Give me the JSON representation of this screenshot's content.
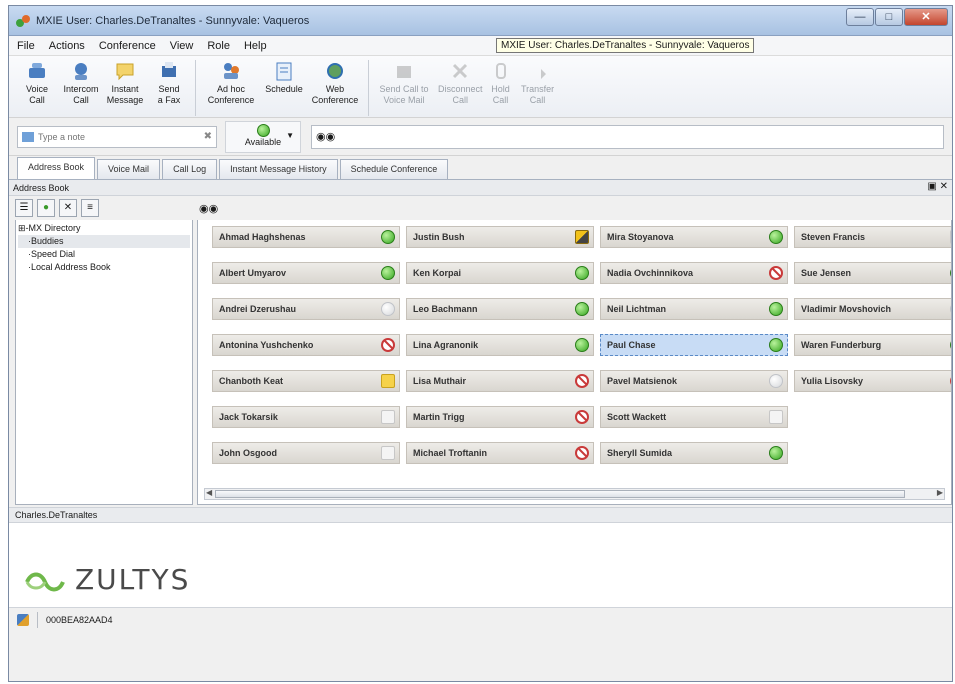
{
  "window": {
    "title": "MXIE User: Charles.DeTranaltes - Sunnyvale: Vaqueros",
    "tooltip": "MXIE User: Charles.DeTranaltes - Sunnyvale: Vaqueros"
  },
  "menu": [
    "File",
    "Actions",
    "Conference",
    "View",
    "Role",
    "Help"
  ],
  "toolbar": {
    "group1": [
      {
        "label": "Voice\nCall",
        "icon": "voice-call-icon"
      },
      {
        "label": "Intercom\nCall",
        "icon": "intercom-icon"
      },
      {
        "label": "Instant\nMessage",
        "icon": "instant-message-icon"
      },
      {
        "label": "Send\na Fax",
        "icon": "fax-icon"
      }
    ],
    "group2": [
      {
        "label": "Ad hoc\nConference",
        "icon": "adhoc-conference-icon"
      },
      {
        "label": "Schedule",
        "icon": "schedule-icon"
      },
      {
        "label": "Web\nConference",
        "icon": "web-conference-icon"
      }
    ],
    "group3": [
      {
        "label": "Send Call to\nVoice Mail",
        "icon": "voicemail-icon"
      },
      {
        "label": "Disconnect\nCall",
        "icon": "disconnect-icon"
      },
      {
        "label": "Hold\nCall",
        "icon": "hold-icon"
      },
      {
        "label": "Transfer\nCall",
        "icon": "transfer-icon"
      }
    ]
  },
  "note": {
    "placeholder": "Type a note"
  },
  "presence": {
    "label": "Available"
  },
  "tabs": [
    "Address Book",
    "Voice Mail",
    "Call Log",
    "Instant Message History",
    "Schedule Conference"
  ],
  "address_book": {
    "header": "Address Book",
    "tree": [
      "MX Directory",
      "Buddies",
      "Speed Dial",
      "Local Address Book"
    ],
    "columns": [
      [
        {
          "name": "Ahmad Haghshenas",
          "status": "green"
        },
        {
          "name": "Albert Umyarov",
          "status": "green"
        },
        {
          "name": "Andrei Dzerushau",
          "status": "off"
        },
        {
          "name": "Antonina Yushchenko",
          "status": "dnd"
        },
        {
          "name": "Chanboth Keat",
          "status": "note"
        },
        {
          "name": "Jack Tokarsik",
          "status": "phone"
        },
        {
          "name": "John Osgood",
          "status": "phone"
        }
      ],
      [
        {
          "name": "Justin Bush",
          "status": "busy"
        },
        {
          "name": "Ken Korpai",
          "status": "green"
        },
        {
          "name": "Leo Bachmann",
          "status": "green"
        },
        {
          "name": "Lina Agranonik",
          "status": "green"
        },
        {
          "name": "Lisa Muthair",
          "status": "dnd"
        },
        {
          "name": "Martin Trigg",
          "status": "dnd"
        },
        {
          "name": "Michael Troftanin",
          "status": "dnd"
        }
      ],
      [
        {
          "name": "Mira Stoyanova",
          "status": "green"
        },
        {
          "name": "Nadia Ovchinnikova",
          "status": "dnd"
        },
        {
          "name": "Neil Lichtman",
          "status": "green"
        },
        {
          "name": "Paul Chase",
          "status": "green",
          "selected": true
        },
        {
          "name": "Pavel Matsienok",
          "status": "off"
        },
        {
          "name": "Scott Wackett",
          "status": "phone"
        },
        {
          "name": "Sheryll Sumida",
          "status": "green"
        }
      ],
      [
        {
          "name": "Steven Francis",
          "status": "phone"
        },
        {
          "name": "Sue Jensen",
          "status": "green"
        },
        {
          "name": "Vladimir Movshovich",
          "status": "off"
        },
        {
          "name": "Waren Funderburg",
          "status": "green"
        },
        {
          "name": "Yulia Lisovsky",
          "status": "dnd"
        }
      ]
    ]
  },
  "user_panel": {
    "name": "Charles.DeTranaltes"
  },
  "brand": {
    "logo_text": "ZULTYS"
  },
  "status_bar": {
    "id": "000BEA82AAD4"
  },
  "colors": {
    "available": "#36a620",
    "dnd": "#c93a3a",
    "selected": "#c8dcf5"
  }
}
